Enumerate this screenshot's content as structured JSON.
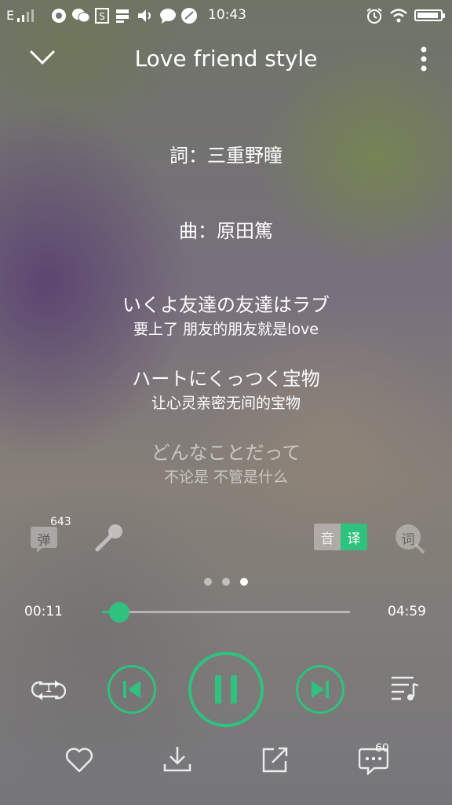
{
  "status_bar": {
    "signal_text": "E",
    "time": "10:43",
    "battery_level": 0.92
  },
  "header": {
    "title": "Love friend style"
  },
  "lyrics": {
    "credit_lyrics": "詞：三重野瞳",
    "credit_music": "曲：原田篤",
    "lines": [
      {
        "original": "いくよ友達の友達はラブ",
        "translation": "要上了 朋友的朋友就是love"
      },
      {
        "original": "ハートにくっつく宝物",
        "translation": "让心灵亲密无间的宝物"
      },
      {
        "original": "どんなことだって",
        "translation": "不论是 不管是什么"
      }
    ]
  },
  "tools": {
    "danmaku_label": "弹",
    "danmaku_count": "643",
    "yin_label": "音",
    "yi_label": "译",
    "lyric_search_label": "词"
  },
  "pager": {
    "total": 3,
    "active": 3
  },
  "playback": {
    "elapsed": "00:11",
    "duration": "04:59",
    "progress_fraction": 0.037,
    "repeat_badge": "1"
  },
  "actions": {
    "comment_count": "60"
  },
  "colors": {
    "accent": "#2ec27e"
  },
  "icons": [
    "chevron-down-icon",
    "more-vertical-icon",
    "danmaku-icon",
    "microphone-icon",
    "lyric-search-icon",
    "repeat-one-icon",
    "previous-icon",
    "pause-icon",
    "next-icon",
    "playlist-icon",
    "heart-icon",
    "download-icon",
    "share-icon",
    "comment-icon"
  ]
}
